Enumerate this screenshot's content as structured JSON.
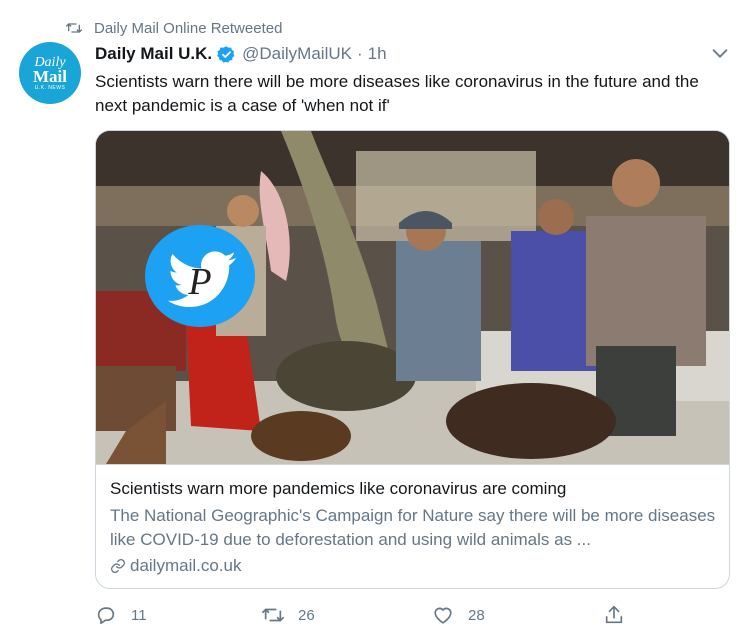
{
  "retweet": {
    "icon": "retweet-icon",
    "text": "Daily Mail Online Retweeted"
  },
  "account": {
    "avatar_line1": "Daily",
    "avatar_line2": "Mail",
    "avatar_line3": "U.K. NEWS",
    "name": "Daily Mail U.K.",
    "verified_icon": "verified-badge-icon",
    "handle": "@DailyMailUK",
    "separator": "·",
    "time": "1h"
  },
  "tweet": {
    "text": "Scientists warn there will be more diseases like coronavirus in the future and the next pandemic is a case of 'when not if'"
  },
  "card": {
    "image_overlay_letter": "P",
    "title": "Scientists warn more pandemics like coronavirus are coming",
    "description": "The National Geographic's Campaign for Nature say there will be more diseases like COVID-19 due to deforestation and using wild animals as ...",
    "domain": "dailymail.co.uk"
  },
  "actions": {
    "reply": {
      "icon": "reply-icon",
      "count": "11"
    },
    "retweet": {
      "icon": "retweet-icon",
      "count": "26"
    },
    "like": {
      "icon": "heart-icon",
      "count": "28"
    },
    "share": {
      "icon": "share-icon"
    }
  },
  "colors": {
    "twitter_blue": "#1da1f2",
    "muted": "#657786",
    "text": "#14171a",
    "border": "#ccd6dd"
  }
}
